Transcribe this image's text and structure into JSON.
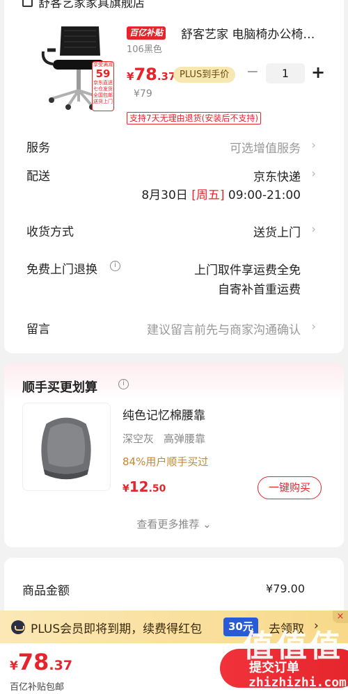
{
  "store": {
    "name": "舒客艺家家具旗舰店",
    "icon": "store-icon"
  },
  "product": {
    "subsidy_tag": "百亿补贴",
    "title": "舒客艺家 电脑椅办公椅家用电竞椅",
    "variant": "106黑色",
    "price_yen": "¥",
    "price_int": "78",
    "price_dec": ".37",
    "plus_label": "PLUS到手价",
    "original_price": "¥79",
    "quantity": "1",
    "minus_symbol": "−",
    "plus_symbol": "+",
    "return_policy": "支持7天无理由退货(安装后不支持)",
    "image_badge": {
      "top": "享受满减",
      "big": "59",
      "l1": "京东直送",
      "l2": "七仓发货",
      "l3": "全国包邮",
      "l4": "送货上门"
    }
  },
  "rows": {
    "service": {
      "label": "服务",
      "value": "可选增值服务"
    },
    "delivery": {
      "label": "配送",
      "carrier": "京东快递",
      "date": "8月30日",
      "weekday": "[周五]",
      "time": "09:00-21:00"
    },
    "receive": {
      "label": "收货方式",
      "value": "送货上门"
    },
    "free_return": {
      "label": "免费上门退换",
      "line1": "上门取件享运费全免",
      "line2": "自寄补首重运费"
    },
    "message": {
      "label": "留言",
      "placeholder": "建议留言前先与商家沟通确认"
    },
    "chevron": "›"
  },
  "recommend": {
    "title": "顺手买更划算",
    "item_name": "纯色记忆棉腰靠",
    "spec_color": "深空灰",
    "spec_type": "高弹腰靠",
    "stat": "84%用户顺手买过",
    "price_yen": "¥",
    "price_int": "12",
    "price_dec": ".50",
    "buy_label": "一键购买",
    "more_label": "查看更多推荐 ⌄"
  },
  "summary": {
    "amount_label": "商品金额",
    "amount_value": "¥79.00"
  },
  "plus_banner": {
    "text": "PLUS会员即将到期，续费得红包",
    "coupon": "30元",
    "action": "去领取",
    "close": "×"
  },
  "bottom": {
    "price_yen": "¥",
    "price_int": "78",
    "price_dec": ".37",
    "subtitle": "百亿补贴包邮",
    "submit_label": "提交订单"
  },
  "watermark": {
    "chars": [
      "值",
      "值",
      "值"
    ],
    "url": "zhizhizhi.com"
  },
  "colors": {
    "accent": "#e5252c",
    "plus_gold": "#f7e7b0",
    "coupon_blue": "#2a5bd7"
  }
}
